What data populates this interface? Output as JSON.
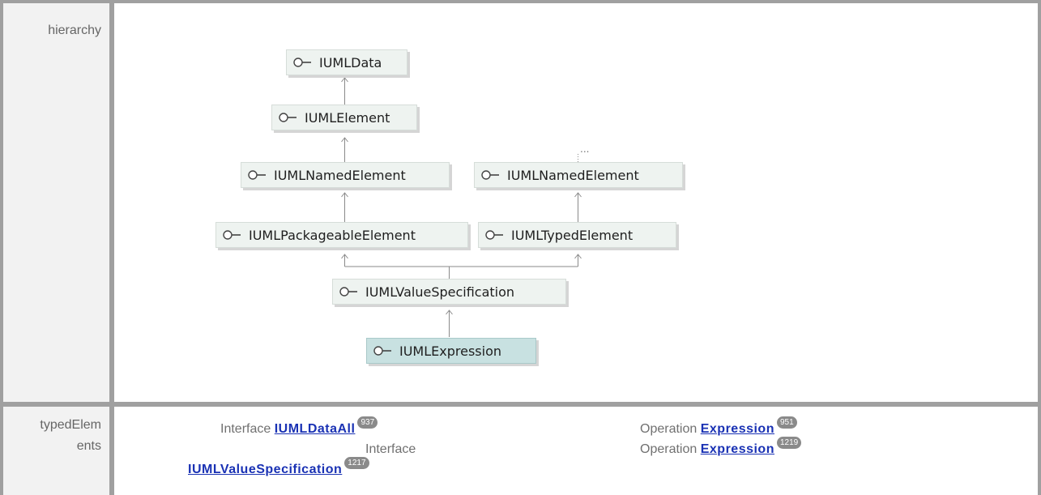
{
  "rows": {
    "hierarchy_label": "hierarchy",
    "typed_label_line1": "typedElem",
    "typed_label_line2": "ents"
  },
  "diagram": {
    "nodes": {
      "uml_data": "IUMLData",
      "uml_element": "IUMLElement",
      "uml_named_element_left": "IUMLNamedElement",
      "uml_named_element_right": "IUMLNamedElement",
      "uml_packageable_element": "IUMLPackageableElement",
      "uml_typed_element": "IUMLTypedElement",
      "uml_value_specification": "IUMLValueSpecification",
      "uml_expression": "IUMLExpression"
    },
    "ellipsis": "..."
  },
  "typed_elements": [
    {
      "kind": "Interface",
      "name": "IUMLDataAll",
      "badge": "937"
    },
    {
      "kind": "Interface",
      "name": "IUMLValueSpecification",
      "badge": "1217"
    },
    {
      "kind": "Operation",
      "name": "Expression",
      "badge": "951"
    },
    {
      "kind": "Operation",
      "name": "Expression",
      "badge": "1219"
    }
  ],
  "colors": {
    "node_fill": "#eef3f0",
    "node_active_fill": "#c8e1e1",
    "link": "#1a32b4",
    "label_bg": "#f2f2f2",
    "border": "#a0a0a0"
  },
  "icons": {
    "interface": "interface-lollipop-icon"
  }
}
